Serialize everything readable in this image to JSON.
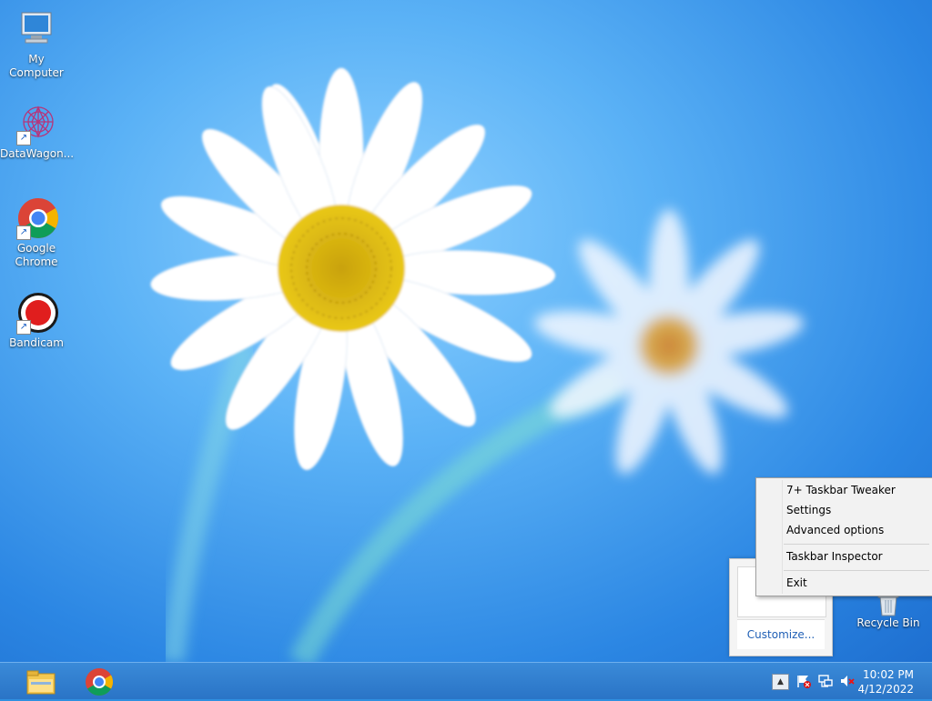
{
  "desktop": {
    "icons": [
      {
        "label": "My Computer",
        "icon": "computer-icon"
      },
      {
        "label": "DataWagon...",
        "icon": "datawagon-icon"
      },
      {
        "label": "Google Chrome",
        "icon": "chrome-icon"
      },
      {
        "label": "Bandicam",
        "icon": "bandicam-icon"
      }
    ],
    "recycle_bin": {
      "label": "Recycle Bin",
      "icon": "recycle-bin-icon"
    }
  },
  "context_menu": {
    "items": [
      {
        "label": "7+ Taskbar Tweaker"
      },
      {
        "label": "Settings"
      },
      {
        "label": "Advanced options"
      },
      {
        "label": "Taskbar Inspector"
      },
      {
        "label": "Exit"
      }
    ]
  },
  "tray_overflow": {
    "customize_label": "Customize..."
  },
  "taskbar": {
    "pinned": [
      {
        "name": "File Explorer",
        "icon": "file-explorer-icon"
      },
      {
        "name": "Google Chrome",
        "icon": "chrome-icon"
      }
    ],
    "tray": {
      "up_arrow": "▲",
      "icons": [
        "action-center-flag-icon",
        "network-icon",
        "volume-muted-icon"
      ]
    },
    "clock": {
      "time": "10:02 PM",
      "date": "4/12/2022"
    }
  },
  "colors": {
    "taskbar": "#2a74c6",
    "wallpaper": "#2f8fe0",
    "menu_bg": "#f2f2f2",
    "link": "#1f5fb5"
  }
}
